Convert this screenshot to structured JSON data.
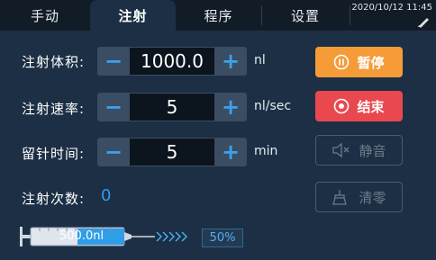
{
  "tabs": [
    {
      "label": "手动"
    },
    {
      "label": "注射"
    },
    {
      "label": "程序"
    },
    {
      "label": "设置"
    }
  ],
  "active_tab": "注射",
  "datetime": "2020/10/12 11:45",
  "rows": [
    {
      "label": "注射体积:",
      "value": "1000.0",
      "unit": "nl"
    },
    {
      "label": "注射速率:",
      "value": "5",
      "unit": "nl/sec"
    },
    {
      "label": "留针时间:",
      "value": "5",
      "unit": "min"
    }
  ],
  "stepper_symbols": {
    "minus": "−",
    "plus": "+"
  },
  "count": {
    "label": "注射次数:",
    "value": "0"
  },
  "buttons": {
    "pause": "暂停",
    "stop": "结束",
    "mute": "静音",
    "clear": "清零"
  },
  "syringe": {
    "volume_text": "500.0nl",
    "progress_text": "50%",
    "fill_fraction": 0.5
  },
  "colors": {
    "background": "#1c2f44",
    "tabbar": "#121c27",
    "accent_blue": "#3da2ee",
    "pause_orange": "#f59b38",
    "stop_red": "#e9484f",
    "disabled_gray": "#6c7a88"
  },
  "icons": {
    "pause": "pause-circle-icon",
    "stop": "stop-circle-icon",
    "mute": "speaker-muted-icon",
    "clear": "broom-icon",
    "pen": "pen-icon"
  }
}
